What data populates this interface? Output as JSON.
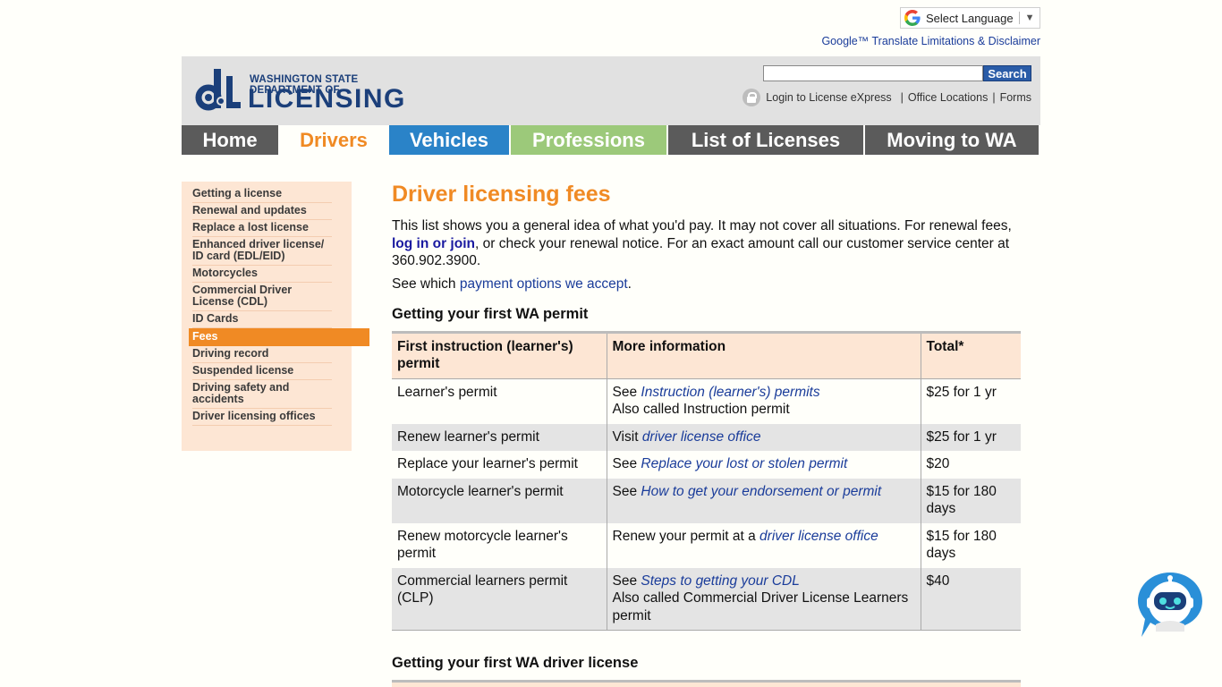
{
  "translate": {
    "select_label": "Select Language",
    "arrow": "▼",
    "disclaimer": "Google™ Translate Limitations & Disclaimer"
  },
  "header": {
    "logo_small": "WASHINGTON STATE DEPARTMENT OF",
    "logo_big": "LICENSING",
    "search_placeholder": "",
    "search_button": "Search",
    "login_link": "Login to License eXpress",
    "office_link": "Office Locations",
    "forms_link": "Forms",
    "pipe": "|"
  },
  "nav": {
    "home": "Home",
    "drivers": "Drivers",
    "vehicles": "Vehicles",
    "professions": "Professions",
    "licenses": "List of Licenses",
    "moving": "Moving to WA"
  },
  "sidebar": {
    "items": [
      "Getting a license",
      "Renewal and updates",
      "Replace a lost license",
      "Enhanced driver license/ ID card (EDL/EID)",
      "Motorcycles",
      "Commercial Driver License (CDL)",
      "ID Cards",
      "Fees",
      "Driving record",
      "Suspended license",
      "Driving safety and accidents",
      "Driver licensing offices"
    ]
  },
  "main": {
    "title": "Driver licensing fees",
    "intro_1": "This list shows you a general idea of what you'd pay. It may not cover all situations. For renewal fees, ",
    "intro_link": "log in or join",
    "intro_2": ", or check your renewal notice. For an exact amount call our customer service center at 360.902.3900.",
    "pay_prefix": "See which ",
    "pay_link": "payment options we accept",
    "pay_suffix": ".",
    "section_1": "Getting your first WA permit",
    "section_2": "Getting your first WA driver license",
    "table": {
      "headers": [
        "First instruction (learner's) permit",
        "More information",
        "Total*"
      ],
      "rows": [
        {
          "name": "Learner's permit",
          "pre": "See ",
          "link": "Instruction (learner's) permits",
          "post": "",
          "extra": "Also called Instruction permit",
          "total": "$25 for 1 yr"
        },
        {
          "name": "Renew learner's permit",
          "pre": "Visit ",
          "link": "driver license office",
          "post": "",
          "extra": "",
          "total": "$25 for 1 yr"
        },
        {
          "name": "Replace your learner's permit",
          "pre": "See ",
          "link": "Replace your lost or stolen permit",
          "post": "",
          "extra": "",
          "total": "$20"
        },
        {
          "name": "Motorcycle learner's permit",
          "pre": "See ",
          "link": "How to get your endorsement or permit",
          "post": "",
          "extra": "",
          "total": "$15 for 180 days"
        },
        {
          "name": "Renew motorcycle learner's permit",
          "pre": "Renew your permit at a ",
          "link": "driver license office",
          "post": "",
          "extra": "",
          "total": "$15 for 180 days"
        },
        {
          "name": "Commercial learners permit (CLP)",
          "pre": "See ",
          "link": "Steps to getting your CDL",
          "post": "",
          "extra": "Also called Commercial Driver License Learners permit",
          "total": "$40"
        }
      ]
    }
  },
  "colors": {
    "accent_orange": "#f08a24",
    "brand_blue": "#1b3f7a",
    "vehicles_blue": "#2a83c8",
    "professions_green": "#9cc97a",
    "nav_gray": "#5b5b5b",
    "sidebar_bg": "#fde6d4"
  }
}
